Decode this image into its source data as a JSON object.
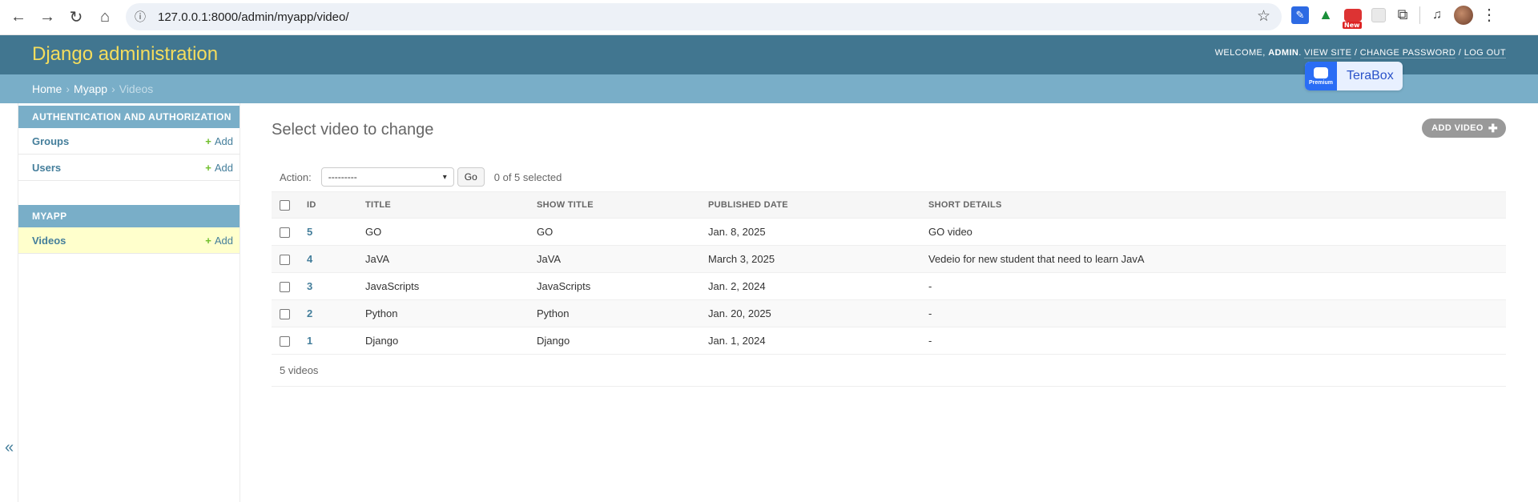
{
  "browser": {
    "url": "127.0.0.1:8000/admin/myapp/video/"
  },
  "header": {
    "brand": "Django administration",
    "welcome": "WELCOME,",
    "username": "ADMIN",
    "view_site": "VIEW SITE",
    "change_password": "CHANGE PASSWORD",
    "log_out": "LOG OUT",
    "separator": "/"
  },
  "terabox": {
    "label": "TeraBox",
    "badge": "Premium"
  },
  "breadcrumbs": {
    "home": "Home",
    "app": "Myapp",
    "current": "Videos",
    "sep": "›"
  },
  "sidebar": {
    "collapse_icon": "«",
    "modules": [
      {
        "caption": "AUTHENTICATION AND AUTHORIZATION",
        "rows": [
          {
            "label": "Groups",
            "add": "Add"
          },
          {
            "label": "Users",
            "add": "Add"
          }
        ]
      },
      {
        "caption": "MYAPP",
        "rows": [
          {
            "label": "Videos",
            "add": "Add"
          }
        ]
      }
    ]
  },
  "main": {
    "title": "Select video to change",
    "add_button": "ADD VIDEO",
    "action_label": "Action:",
    "action_selected": "---------",
    "go_button": "Go",
    "selected_count": "0 of 5 selected",
    "columns": [
      "ID",
      "TITLE",
      "SHOW TITLE",
      "PUBLISHED DATE",
      "SHORT DETAILS"
    ],
    "rows": [
      {
        "id": "5",
        "title": "GO",
        "show_title": "GO",
        "published": "Jan. 8, 2025",
        "details": "GO video"
      },
      {
        "id": "4",
        "title": "JaVA",
        "show_title": "JaVA",
        "published": "March 3, 2025",
        "details": "Vedeio for new student that need to learn JavA"
      },
      {
        "id": "3",
        "title": "JavaScripts",
        "show_title": "JavaScripts",
        "published": "Jan. 2, 2024",
        "details": "-"
      },
      {
        "id": "2",
        "title": "Python",
        "show_title": "Python",
        "published": "Jan. 20, 2025",
        "details": "-"
      },
      {
        "id": "1",
        "title": "Django",
        "show_title": "Django",
        "published": "Jan. 1, 2024",
        "details": "-"
      }
    ],
    "paginator": "5 videos"
  },
  "colors": {
    "header_bg": "#417690",
    "brand": "#f5dd5d",
    "breadcrumbs_bg": "#79aec8",
    "link": "#447e9b",
    "add_green": "#70bf2b",
    "selected_row": "#ffffcc"
  }
}
